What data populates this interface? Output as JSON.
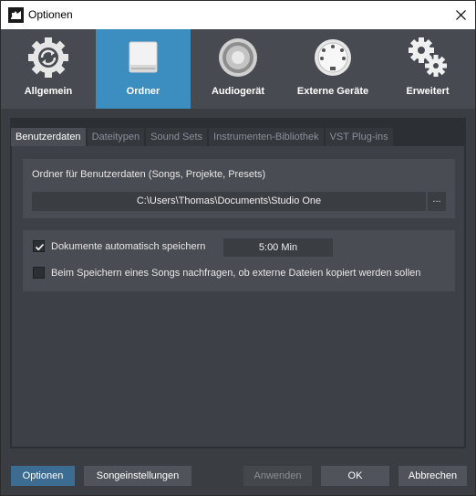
{
  "window": {
    "title": "Optionen"
  },
  "toolbar": {
    "items": [
      {
        "label": "Allgemein",
        "icon": "gear-refresh-icon"
      },
      {
        "label": "Ordner",
        "icon": "drive-icon",
        "active": true
      },
      {
        "label": "Audiogerät",
        "icon": "speaker-icon"
      },
      {
        "label": "Externe Geräte",
        "icon": "midi-connector-icon"
      },
      {
        "label": "Erweitert",
        "icon": "gears-icon"
      }
    ]
  },
  "tabs": [
    "Benutzerdaten",
    "Dateitypen",
    "Sound Sets",
    "Instrumenten-Bibliothek",
    "VST Plug-ins"
  ],
  "active_tab": "Benutzerdaten",
  "user_data": {
    "folder_label": "Ordner für Benutzerdaten (Songs, Projekte, Presets)",
    "folder_path": "C:\\Users\\Thomas\\Documents\\Studio One",
    "browse_label": "..."
  },
  "autosave": {
    "label": "Dokumente automatisch speichern",
    "checked": true,
    "interval": "5:00 Min"
  },
  "ask_copy": {
    "label": "Beim Speichern eines Songs nachfragen, ob externe Dateien kopiert werden sollen",
    "checked": false
  },
  "buttons": {
    "options": "Optionen",
    "song_settings": "Songeinstellungen",
    "apply": "Anwenden",
    "ok": "OK",
    "cancel": "Abbrechen"
  },
  "colors": {
    "accent": "#3c8ec1",
    "toolbar_bg": "#474b51",
    "content_bg": "#2c2f33"
  }
}
